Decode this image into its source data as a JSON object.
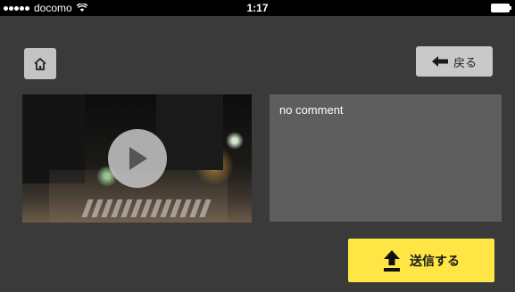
{
  "status_bar": {
    "carrier": "docomo",
    "time": "1:17",
    "signal_icon": "signal-dots-icon",
    "wifi_icon": "wifi-icon",
    "battery_icon": "battery-icon"
  },
  "header": {
    "home_icon": "home-icon",
    "back_label": "戻る",
    "back_icon": "arrow-left-icon"
  },
  "video": {
    "play_icon": "play-icon"
  },
  "comment": {
    "text": "no comment"
  },
  "footer": {
    "send_label": "送信する",
    "send_icon": "upload-icon"
  },
  "colors": {
    "background": "#3a3a3a",
    "comment_bg": "#5e5e5e",
    "button_gray": "#c9c9c9",
    "send_yellow": "#ffe645"
  }
}
